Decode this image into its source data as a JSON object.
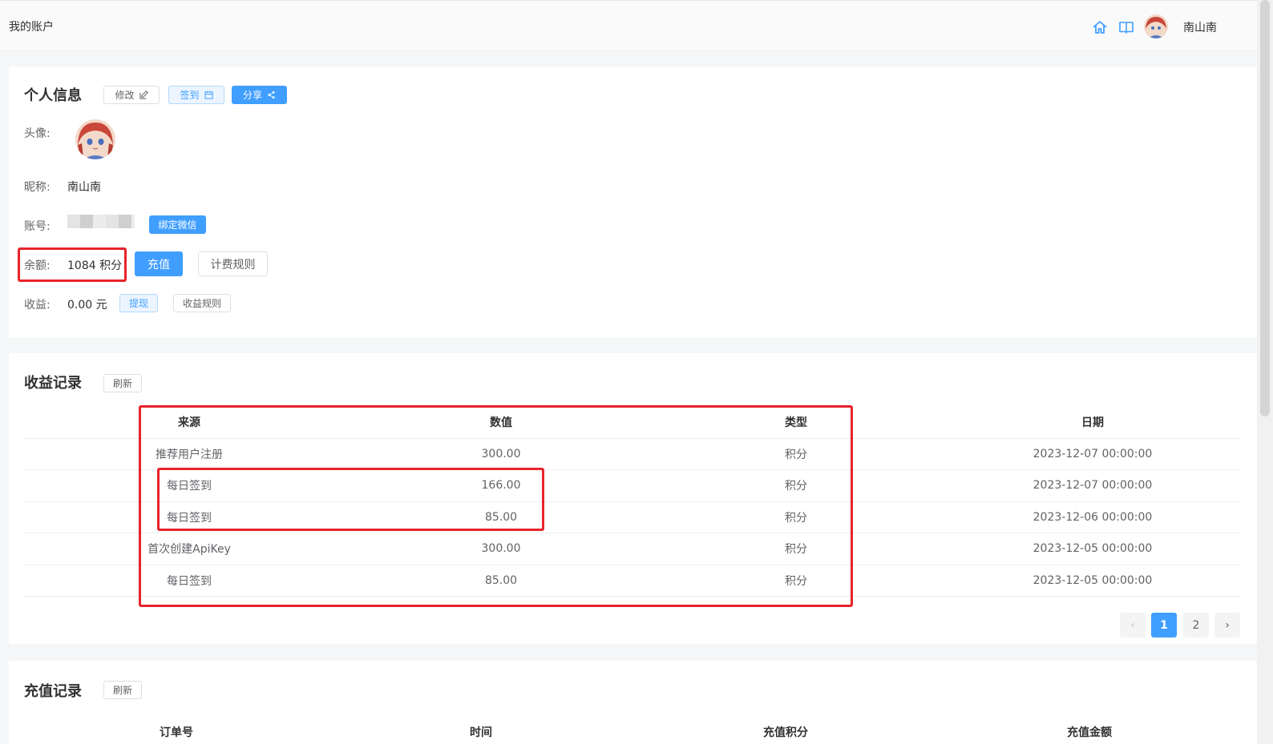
{
  "header": {
    "page_label": "我的账户",
    "user_name": "南山南",
    "icons": [
      "home-icon",
      "book-icon"
    ]
  },
  "profile": {
    "title": "个人信息",
    "edit_label": "修改",
    "checkin_label": "签到",
    "share_label": "分享",
    "avatar_label": "头像:",
    "nickname_label": "昵称:",
    "nickname": "南山南",
    "account_label": "账号:",
    "bind_wechat_label": "绑定微信",
    "balance_label": "余额:",
    "balance_value": "1084 积分",
    "recharge_label": "充值",
    "billing_rules_label": "计费规则",
    "income_label": "收益:",
    "income_value": "0.00 元",
    "withdraw_label": "提现",
    "income_rules_label": "收益规则"
  },
  "income_records": {
    "title": "收益记录",
    "refresh_label": "刷新",
    "columns": [
      "来源",
      "数值",
      "类型",
      "日期"
    ],
    "rows": [
      [
        "推荐用户注册",
        "300.00",
        "积分",
        "2023-12-07 00:00:00"
      ],
      [
        "每日签到",
        "166.00",
        "积分",
        "2023-12-07 00:00:00"
      ],
      [
        "每日签到",
        "85.00",
        "积分",
        "2023-12-06 00:00:00"
      ],
      [
        "首次创建ApiKey",
        "300.00",
        "积分",
        "2023-12-05 00:00:00"
      ],
      [
        "每日签到",
        "85.00",
        "积分",
        "2023-12-05 00:00:00"
      ]
    ],
    "pagination": {
      "prev": "‹",
      "pages": [
        "1",
        "2"
      ],
      "current": "1",
      "next": "›"
    }
  },
  "recharge_records": {
    "title": "充值记录",
    "refresh_label": "刷新",
    "columns": [
      "订单号",
      "时间",
      "充值积分",
      "充值金额"
    ]
  },
  "colors": {
    "primary": "#409eff",
    "highlight": "#e8232a"
  }
}
